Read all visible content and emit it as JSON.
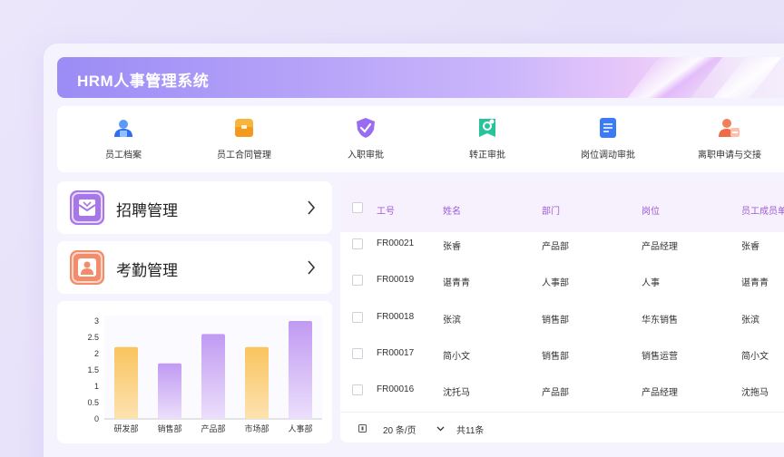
{
  "app": {
    "title": "HRM人事管理系统"
  },
  "quick_menu": [
    {
      "label": "员工档案",
      "icon": "employee-file-icon",
      "color": "#3b82f6"
    },
    {
      "label": "员工合同管理",
      "icon": "contract-icon",
      "color": "#f5a623"
    },
    {
      "label": "入职审批",
      "icon": "onboarding-shield-icon",
      "color": "#8b5cf6"
    },
    {
      "label": "转正审批",
      "icon": "regularization-icon",
      "color": "#22c39a"
    },
    {
      "label": "岗位调动审批",
      "icon": "transfer-doc-icon",
      "color": "#3b7cf6"
    },
    {
      "label": "离职申请与交接",
      "icon": "resignation-icon",
      "color": "#f07b5a"
    }
  ],
  "cards": {
    "recruit": {
      "label": "招聘管理",
      "icon": "recruit-envelope-icon",
      "color": "#a777e8"
    },
    "attendance": {
      "label": "考勤管理",
      "icon": "attendance-person-icon",
      "color": "#f28c6b"
    }
  },
  "chart_data": {
    "type": "bar",
    "categories": [
      "研发部",
      "销售部",
      "产品部",
      "市场部",
      "人事部"
    ],
    "values": [
      2.2,
      1.7,
      2.6,
      2.2,
      3.0
    ],
    "colors": [
      "#f9c86a",
      "#c6a2f3",
      "#c6a2f3",
      "#f9c86a",
      "#c6a2f3"
    ],
    "ylim": [
      0,
      3
    ],
    "yticks": [
      "0",
      "0.5",
      "1",
      "1.5",
      "2",
      "2.5",
      "3"
    ],
    "title": "",
    "xlabel": "",
    "ylabel": ""
  },
  "table": {
    "headers": [
      "工号",
      "姓名",
      "部门",
      "岗位",
      "员工成员单"
    ],
    "rows": [
      [
        "FR00021",
        "张睿",
        "产品部",
        "产品经理",
        "张睿"
      ],
      [
        "FR00019",
        "谌青青",
        "人事部",
        "人事",
        "谌青青"
      ],
      [
        "FR00018",
        "张滨",
        "销售部",
        "华东销售",
        "张滨"
      ],
      [
        "FR00017",
        "简小文",
        "销售部",
        "销售运营",
        "简小文"
      ],
      [
        "FR00016",
        "沈托马",
        "产品部",
        "产品经理",
        "沈拖马"
      ]
    ],
    "page_size": "20 条/页",
    "total": "共11条"
  }
}
